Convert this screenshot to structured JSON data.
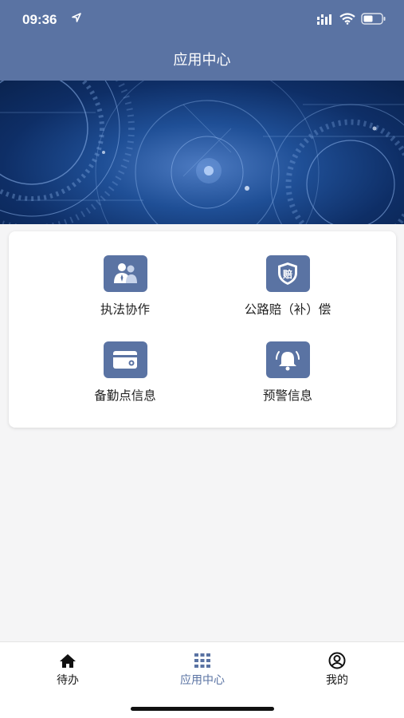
{
  "status": {
    "time": "09:36",
    "icons": [
      "location-arrow-icon",
      "signal-icon",
      "wifi-icon",
      "battery-icon"
    ]
  },
  "header": {
    "title": "应用中心"
  },
  "apps": [
    {
      "label": "执法协作",
      "icon": "users-icon"
    },
    {
      "label": "公路赔（补）偿",
      "icon": "compensation-shield-icon",
      "icon_text": "赔"
    },
    {
      "label": "备勤点信息",
      "icon": "wallet-icon"
    },
    {
      "label": "预警信息",
      "icon": "alarm-bell-icon"
    }
  ],
  "tabbar": {
    "items": [
      {
        "label": "待办",
        "icon": "home-icon",
        "active": false
      },
      {
        "label": "应用中心",
        "icon": "grid-icon",
        "active": true
      },
      {
        "label": "我的",
        "icon": "user-circle-icon",
        "active": false
      }
    ]
  },
  "colors": {
    "primary": "#5a73a3",
    "background": "#f5f5f6"
  }
}
